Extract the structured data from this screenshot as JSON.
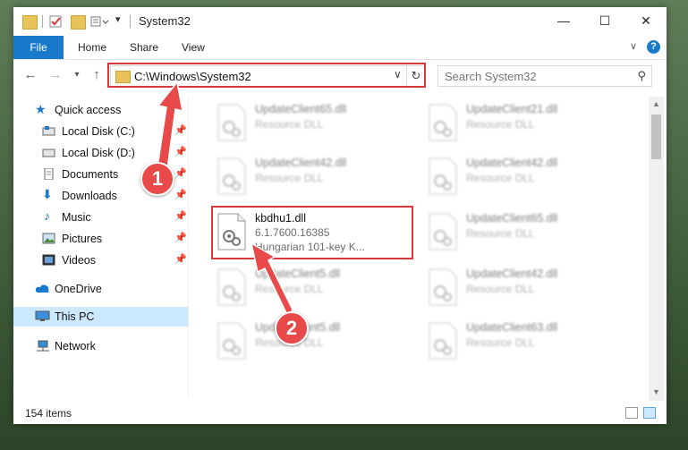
{
  "window": {
    "title": "System32",
    "minimize_glyph": "—",
    "maximize_glyph": "☐",
    "close_glyph": "✕"
  },
  "ribbon": {
    "tabs": [
      "File",
      "Home",
      "Share",
      "View"
    ],
    "help_glyph": "?"
  },
  "nav": {
    "address": "C:\\Windows\\System32",
    "search_placeholder": "Search System32"
  },
  "sidebar": {
    "items": [
      {
        "label": "Quick access",
        "icon": "star-icon",
        "pinned": false
      },
      {
        "label": "Local Disk (C:)",
        "icon": "drive-icon",
        "pinned": true
      },
      {
        "label": "Local Disk (D:)",
        "icon": "drive-icon",
        "pinned": true
      },
      {
        "label": "Documents",
        "icon": "documents-icon",
        "pinned": true
      },
      {
        "label": "Downloads",
        "icon": "download-icon",
        "pinned": true
      },
      {
        "label": "Music",
        "icon": "music-icon",
        "pinned": true
      },
      {
        "label": "Pictures",
        "icon": "pictures-icon",
        "pinned": true
      },
      {
        "label": "Videos",
        "icon": "videos-icon",
        "pinned": true
      },
      {
        "label": "OneDrive",
        "icon": "cloud-icon",
        "pinned": false
      },
      {
        "label": "This PC",
        "icon": "computer-icon",
        "pinned": false,
        "selected": true
      },
      {
        "label": "Network",
        "icon": "network-icon",
        "pinned": false
      }
    ]
  },
  "files": {
    "highlighted": {
      "name": "kbdhu1.dll",
      "version": "6.1.7600.16385",
      "description": "Hungarian 101-key K..."
    },
    "background": [
      {
        "name": "UpdateClient65.dll",
        "type": "Resource DLL"
      },
      {
        "name": "UpdateClient21.dll",
        "type": "Resource DLL"
      },
      {
        "name": "UpdateClient42.dll",
        "type": "Resource DLL"
      },
      {
        "name": "UpdateClient42.dll",
        "type": "Resource DLL"
      },
      {
        "name": "UpdateClient65.dll",
        "type": "Resource DLL"
      },
      {
        "name": "UpdateClient5.dll",
        "type": "Resource DLL"
      },
      {
        "name": "UpdateClient42.dll",
        "type": "Resource DLL"
      },
      {
        "name": "UpdateClient5.dll",
        "type": "Resource DLL"
      },
      {
        "name": "UpdateClient63.dll",
        "type": "Resource DLL"
      }
    ]
  },
  "status": {
    "item_count": "154 items"
  },
  "annotations": {
    "badge_1": "1",
    "badge_2": "2",
    "accent_color": "#d9383a"
  }
}
